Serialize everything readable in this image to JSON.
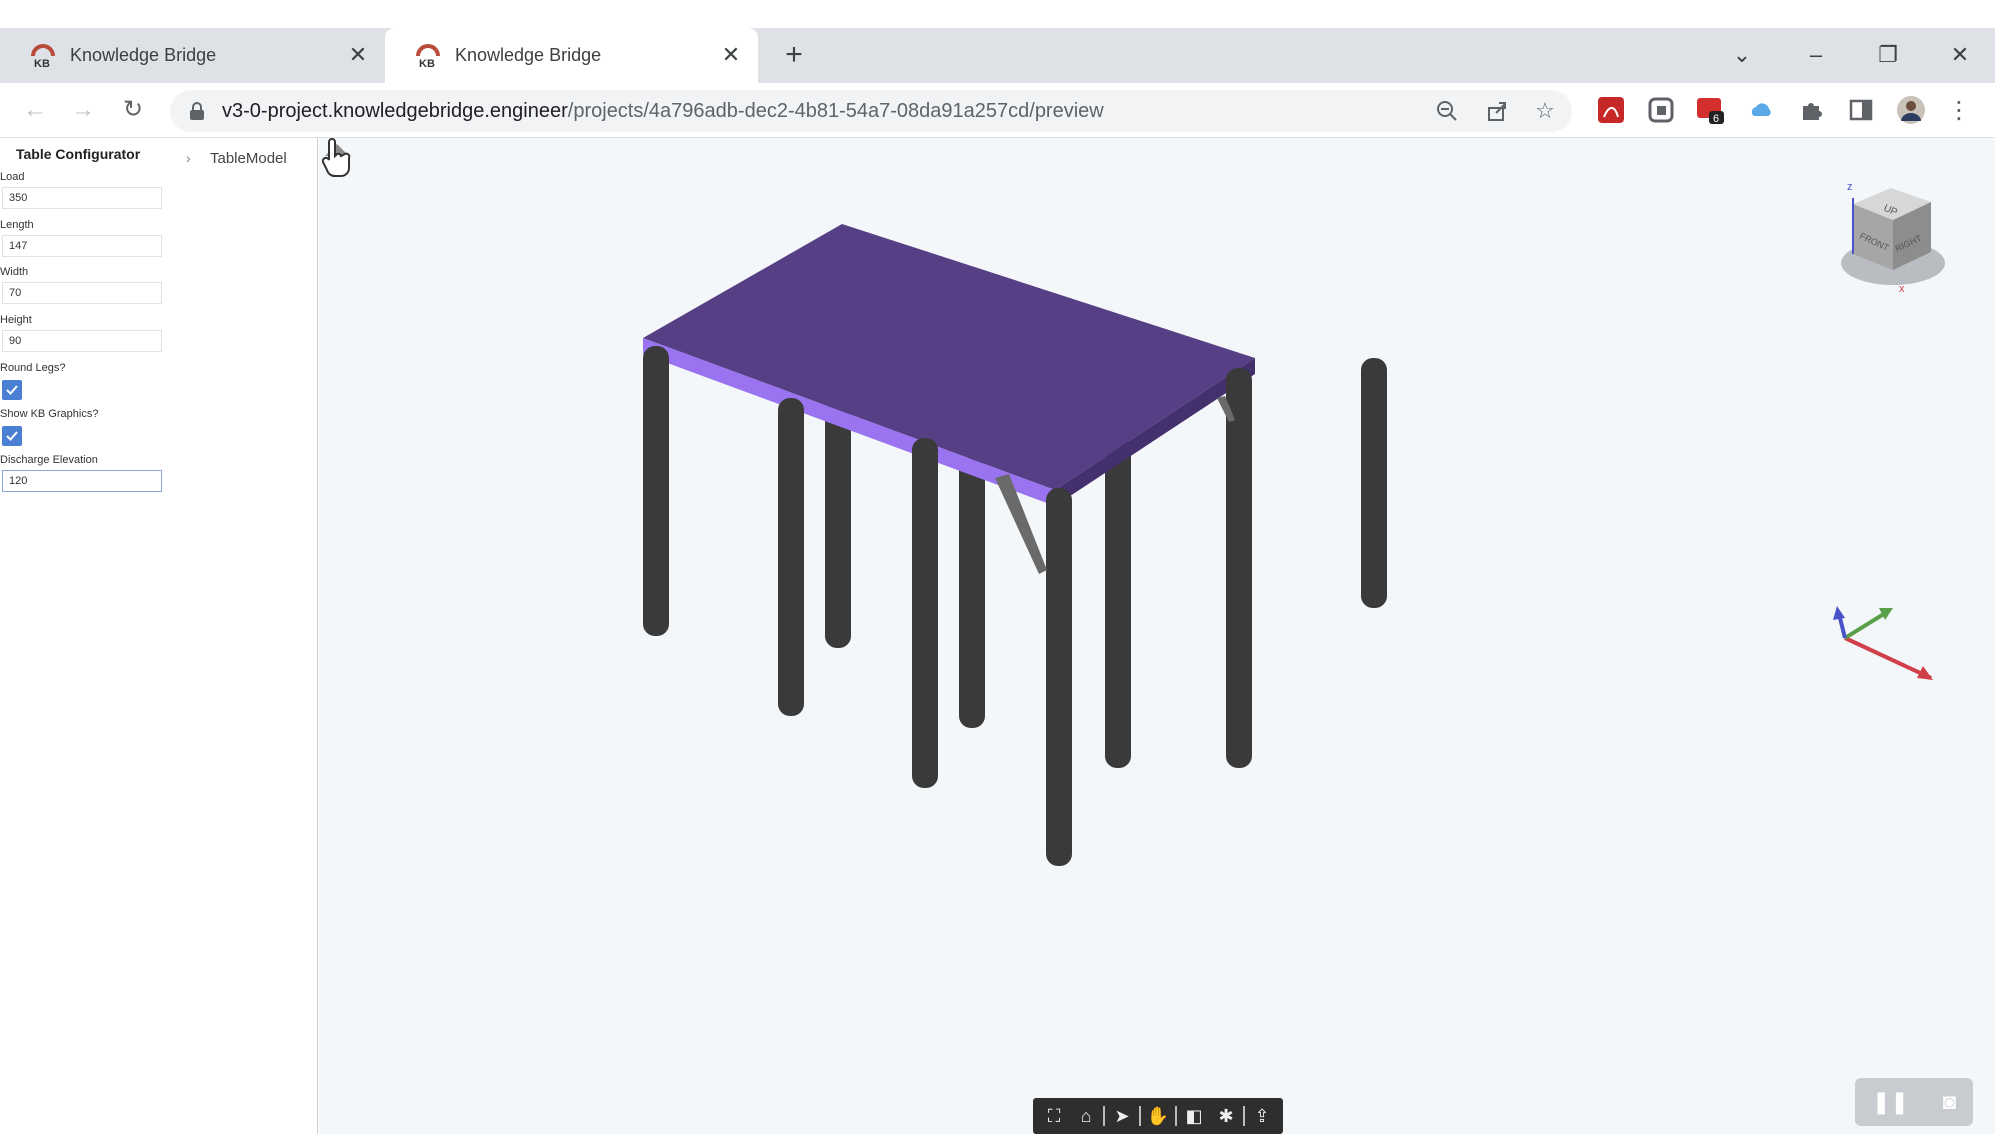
{
  "browser": {
    "tabs": [
      {
        "label": "Knowledge Bridge",
        "active": false
      },
      {
        "label": "Knowledge Bridge",
        "active": true
      }
    ],
    "url_host": "v3-0-project.knowledgebridge.engineer",
    "url_path": "/projects/4a796adb-dec2-4b81-54a7-08da91a257cd/preview",
    "extension_badge": "6",
    "favicon_text": "KB"
  },
  "sidebar": {
    "title": "Table Configurator",
    "breadcrumb": "TableModel",
    "fields": [
      {
        "label": "Load",
        "value": "350",
        "type": "text"
      },
      {
        "label": "Length",
        "value": "147",
        "type": "text"
      },
      {
        "label": "Width",
        "value": "70",
        "type": "text"
      },
      {
        "label": "Height",
        "value": "90",
        "type": "text"
      },
      {
        "label": "Round Legs?",
        "checked": true,
        "type": "checkbox"
      },
      {
        "label": "Show KB Graphics?",
        "checked": true,
        "type": "checkbox"
      },
      {
        "label": "Discharge Elevation",
        "value": "120",
        "type": "text",
        "focused": true
      }
    ]
  },
  "viewer": {
    "viewcube_faces": {
      "top": "UP",
      "front": "FRONT",
      "right": "RIGHT"
    },
    "axis_labels": {
      "z": "z",
      "x": "x"
    },
    "colors": {
      "tabletop": "#573f85",
      "tabletop_edge": "#9a74f0",
      "legs": "#3a3a3a",
      "background": "#f4f7f9",
      "axis_x": "#d0404a",
      "axis_y": "#5aa04a",
      "axis_z": "#4a52c8"
    }
  }
}
